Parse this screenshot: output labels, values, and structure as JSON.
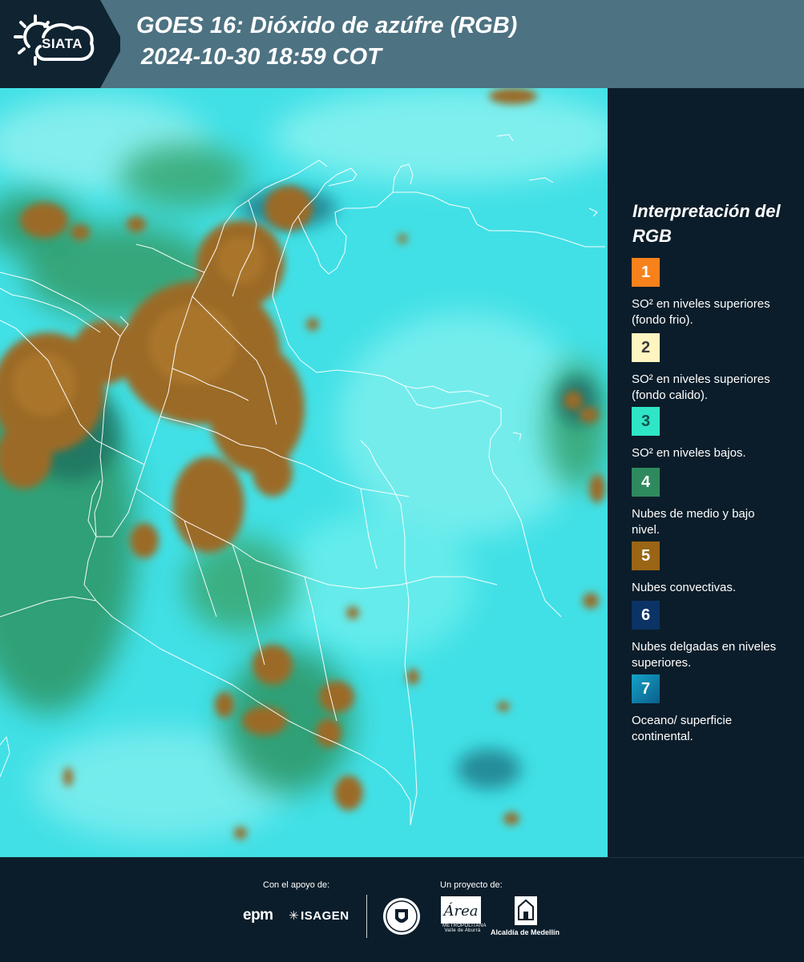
{
  "header": {
    "logo_text": "SIATA",
    "title_line1": "GOES 16: Dióxido de azúfre (RGB)",
    "title_line2": "2024-10-30 18:59 COT"
  },
  "legend": {
    "title": "Interpretación del RGB",
    "items": [
      {
        "number": "1",
        "color": "#f7821c",
        "text": "SO² en niveles superiores (fondo frio)."
      },
      {
        "number": "2",
        "color": "#fff5c0",
        "text": "SO² en niveles superiores (fondo calido)."
      },
      {
        "number": "3",
        "color": "#2ee6c6",
        "text": "SO² en niveles bajos."
      },
      {
        "number": "4",
        "color": "#2e8a5e",
        "text": "Nubes de medio y bajo nivel."
      },
      {
        "number": "5",
        "color": "#9a6514",
        "text": "Nubes convectivas."
      },
      {
        "number": "6",
        "color": "#0b3366",
        "text": "Nubes delgadas en niveles superiores."
      },
      {
        "number": "7",
        "color": "#1c8fb4",
        "text": "Oceano/ superficie continental."
      }
    ]
  },
  "footer": {
    "support_label": "Con el apoyo de:",
    "project_label": "Un proyecto de:",
    "epm": "epm",
    "isagen": "ISAGEN",
    "area_script": "Área",
    "area_subtitle": "METROPOLITANA Valle de Aburrá",
    "alcaldia": "Alcaldía de Medellín"
  },
  "colors": {
    "header_bg": "#4d7282",
    "logo_bg": "#0f2331",
    "page_bg": "#0b1d2a",
    "map_cyan": "#3fe3e6",
    "cloud_brown": "#9a6a2a",
    "cloud_green": "#2f9a6a"
  },
  "icons": [
    "siata-sun-cloud-icon",
    "epm-logo",
    "isagen-logo",
    "medellin-seal-icon",
    "area-metropolitana-logo",
    "alcaldia-building-icon"
  ]
}
